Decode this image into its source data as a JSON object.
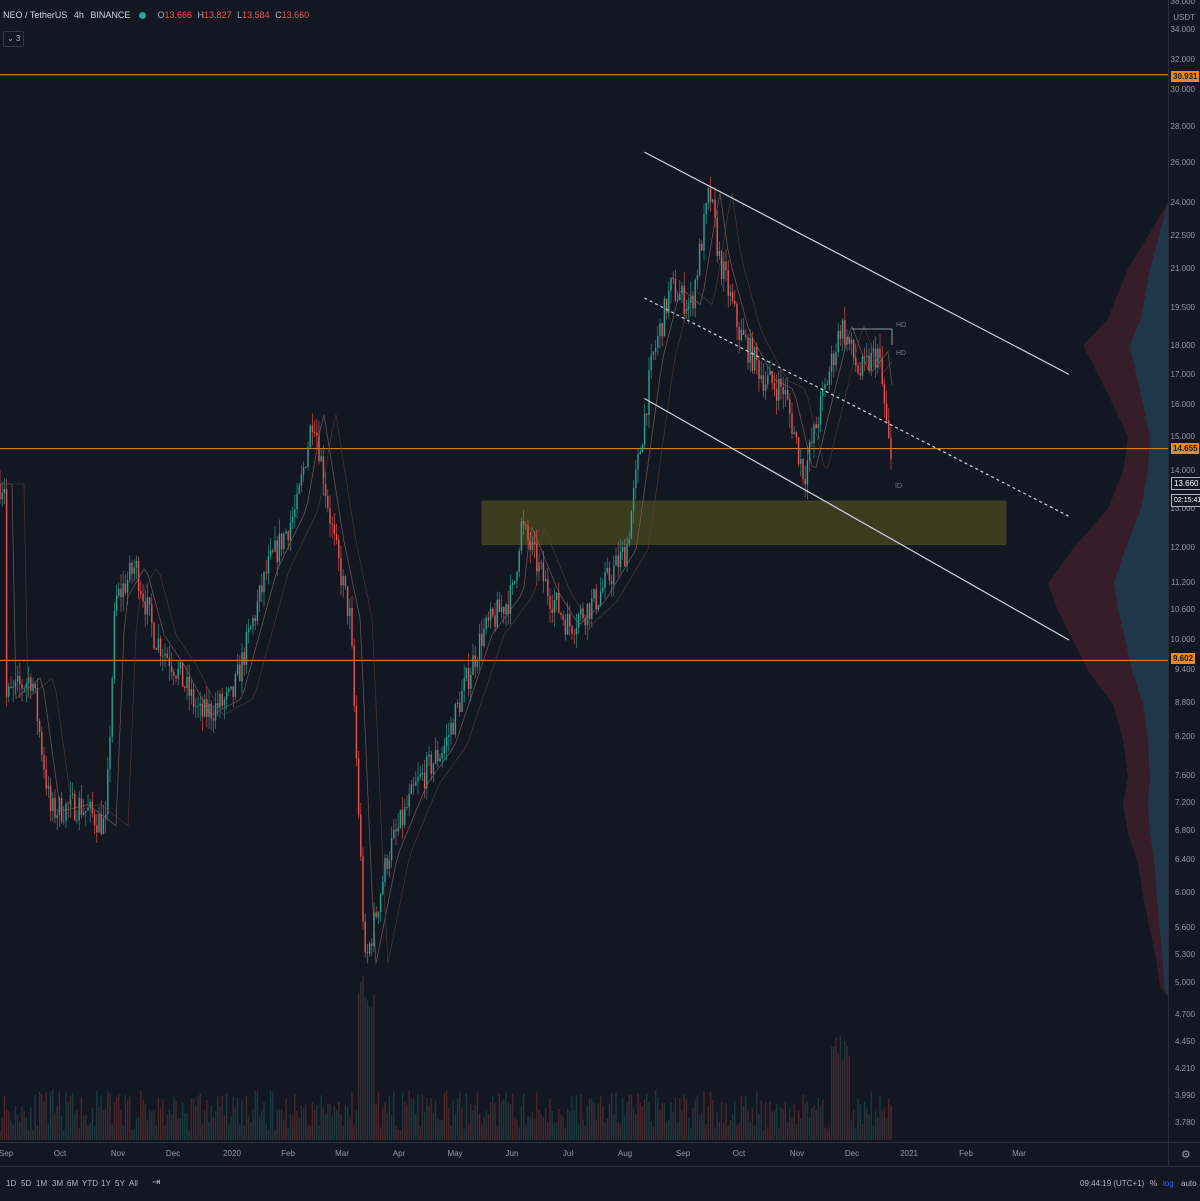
{
  "legend": {
    "symbol": "NEO / TetherUS",
    "interval": "4h",
    "exchange": "BINANCE",
    "open_label": "O",
    "open": "13.666",
    "high_label": "H",
    "high": "13.827",
    "low_label": "L",
    "low": "13.584",
    "close_label": "C",
    "close": "13.660",
    "collapse_label": "⌄ 3"
  },
  "price_scale": {
    "currency": "USDT",
    "ticks": [
      "38.000",
      "34.000",
      "32.000",
      "30.000",
      "28.000",
      "26.000",
      "24.000",
      "22.500",
      "21.000",
      "19.500",
      "18.000",
      "17.000",
      "16.000",
      "15.000",
      "14.000",
      "13.000",
      "12.000",
      "11.200",
      "10.600",
      "10.000",
      "9.400",
      "8.800",
      "8.200",
      "7.600",
      "7.200",
      "6.800",
      "6.400",
      "6.000",
      "5.600",
      "5.300",
      "5.000",
      "4.700",
      "4.450",
      "4.210",
      "3.990",
      "3.780"
    ],
    "levels": {
      "resistance_high": "30.931",
      "mid": "14.655",
      "support": "9.602"
    },
    "last_price": "13.660",
    "countdown": "02:15:41"
  },
  "time_axis": [
    "Sep",
    "Oct",
    "Nov",
    "Dec",
    "2020",
    "Feb",
    "Mar",
    "Apr",
    "May",
    "Jun",
    "Jul",
    "Aug",
    "Sep",
    "Oct",
    "Nov",
    "Dec",
    "2021",
    "Feb",
    "Mar"
  ],
  "range_buttons": [
    "1D",
    "5D",
    "1M",
    "3M",
    "6M",
    "YTD",
    "1Y",
    "5Y",
    "All"
  ],
  "compare_icon": "calendar-goto-icon",
  "bottom_right": {
    "time": "09:44:19 (UTC+1)",
    "percent": "%",
    "log": "log",
    "auto": "auto"
  },
  "markers": [
    "HD",
    "HD",
    "ID"
  ],
  "colors": {
    "background": "#131722",
    "up": "#26a69a",
    "down": "#ef5350",
    "level_line": "#e98a1b",
    "channel": "#d1d4dc",
    "zone": "#5c5a1e",
    "volume_profile": "#3a1f2a",
    "volume_profile_blue": "#1e3a4c"
  },
  "chart_data": {
    "type": "candlestick",
    "title": "",
    "xlabel": "",
    "ylabel": "",
    "yscale": "log",
    "ylim": [
      3.7,
      38
    ],
    "x": [
      "2019-09",
      "2019-10",
      "2019-11",
      "2019-12",
      "2020-01",
      "2020-02",
      "2020-03",
      "2020-04",
      "2020-05",
      "2020-06",
      "2020-07",
      "2020-08",
      "2020-09",
      "2020-10",
      "2020-11",
      "2020-12"
    ],
    "series": [
      {
        "values": [
          8.9,
          7.2,
          10.8,
          8.9,
          8.8,
          15.8,
          12.5,
          6.5,
          8.0,
          12.6,
          10.6,
          13.5,
          22.0,
          17.5,
          14.5,
          17.5
        ]
      }
    ],
    "close_path": [
      [
        "2019-09-01",
        8.9
      ],
      [
        "2019-09-15",
        9.3
      ],
      [
        "2019-09-25",
        7.1
      ],
      [
        "2019-10-10",
        7.2
      ],
      [
        "2019-10-25",
        6.9
      ],
      [
        "2019-10-30",
        10.8
      ],
      [
        "2019-11-10",
        11.6
      ],
      [
        "2019-11-20",
        10.1
      ],
      [
        "2019-12-01",
        9.5
      ],
      [
        "2019-12-15",
        8.6
      ],
      [
        "2020-01-01",
        8.9
      ],
      [
        "2020-01-20",
        11.5
      ],
      [
        "2020-02-05",
        13.0
      ],
      [
        "2020-02-14",
        15.8
      ],
      [
        "2020-02-25",
        12.2
      ],
      [
        "2020-03-05",
        10.4
      ],
      [
        "2020-03-13",
        5.2
      ],
      [
        "2020-03-25",
        6.5
      ],
      [
        "2020-04-10",
        7.5
      ],
      [
        "2020-04-25",
        8.1
      ],
      [
        "2020-05-15",
        10.1
      ],
      [
        "2020-06-01",
        11.0
      ],
      [
        "2020-06-05",
        12.6
      ],
      [
        "2020-06-20",
        11.0
      ],
      [
        "2020-07-01",
        10.3
      ],
      [
        "2020-07-15",
        10.8
      ],
      [
        "2020-08-01",
        12.0
      ],
      [
        "2020-08-15",
        17.5
      ],
      [
        "2020-08-25",
        20.2
      ],
      [
        "2020-09-05",
        19.5
      ],
      [
        "2020-09-15",
        24.5
      ],
      [
        "2020-09-20",
        21.5
      ],
      [
        "2020-10-01",
        18.5
      ],
      [
        "2020-10-15",
        16.8
      ],
      [
        "2020-10-25",
        16.5
      ],
      [
        "2020-11-05",
        13.9
      ],
      [
        "2020-11-15",
        16.2
      ],
      [
        "2020-11-25",
        18.8
      ],
      [
        "2020-12-05",
        17.0
      ],
      [
        "2020-12-15",
        17.8
      ],
      [
        "2020-12-23",
        13.66
      ]
    ],
    "horizontal_levels": [
      30.931,
      14.655,
      9.602
    ],
    "channel_upper": [
      [
        "2020-08-01",
        26.5
      ],
      [
        "2021-03-01",
        17.0
      ]
    ],
    "channel_mid": [
      [
        "2020-08-01",
        19.8
      ],
      [
        "2021-03-01",
        12.8
      ]
    ],
    "channel_lower": [
      [
        "2020-08-01",
        16.2
      ],
      [
        "2021-03-01",
        10.0
      ]
    ],
    "demand_zone": {
      "from": "2020-05-15",
      "to": "2021-02-22",
      "low": 12.1,
      "high": 13.2
    }
  }
}
